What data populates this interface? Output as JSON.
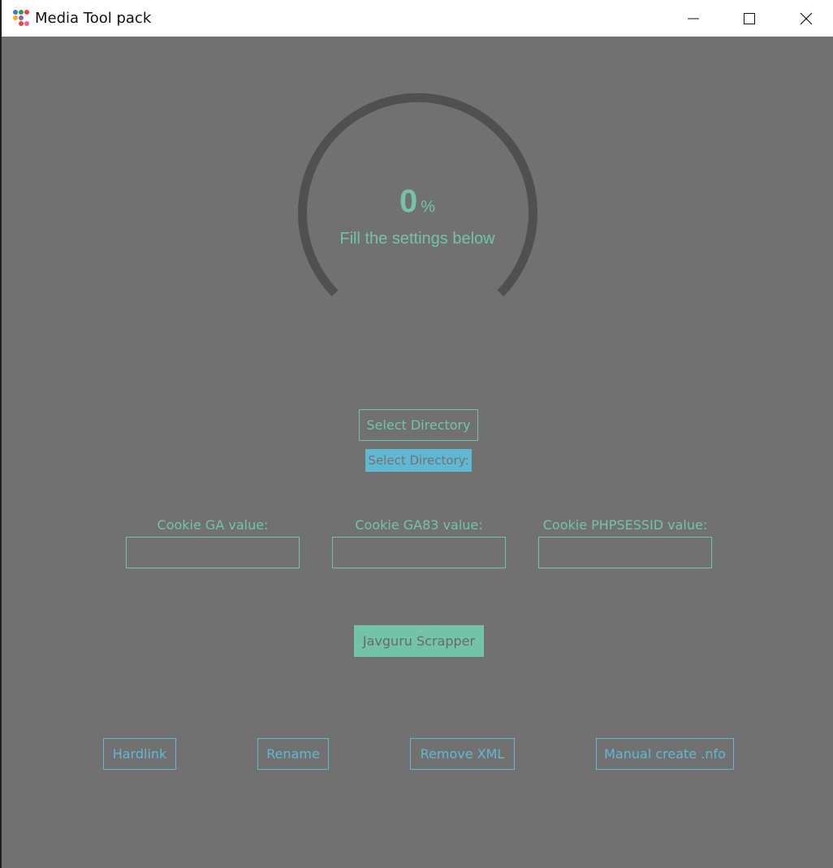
{
  "window": {
    "title": "Media Tool pack",
    "controls": {
      "minimize": "minimize",
      "maximize": "maximize",
      "close": "close"
    }
  },
  "progress": {
    "value": "0",
    "unit": "%",
    "fraction": 0,
    "message": "Fill the settings below"
  },
  "directory": {
    "button_label": "Select Directory",
    "path_label": "Select Directory:"
  },
  "cookies": [
    {
      "label": "Cookie GA value:",
      "value": ""
    },
    {
      "label": "Cookie GA83 value:",
      "value": ""
    },
    {
      "label": "Cookie PHPSESSID value:",
      "value": ""
    }
  ],
  "scrapper_button": "Javguru Scrapper",
  "actions": {
    "hardlink": "Hardlink",
    "rename": "Rename",
    "remove_xml": "Remove XML",
    "manual_nfo": "Manual create .nfo"
  },
  "colors": {
    "background": "#717171",
    "accent_green": "#73c3a8",
    "accent_blue": "#61b8d3",
    "gauge_track": "#505050"
  }
}
